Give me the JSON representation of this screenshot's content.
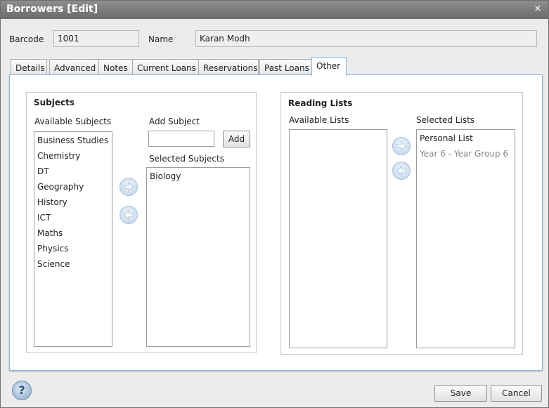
{
  "window": {
    "title": "Borrowers [Edit]",
    "close_glyph": "×"
  },
  "header": {
    "barcode_label": "Barcode",
    "barcode_value": "1001",
    "name_label": "Name",
    "name_value": "Karan Modh"
  },
  "tabs": [
    {
      "label": "Details",
      "active": false
    },
    {
      "label": "Advanced",
      "active": false
    },
    {
      "label": "Notes",
      "active": false
    },
    {
      "label": "Current Loans",
      "active": false
    },
    {
      "label": "Reservations",
      "active": false
    },
    {
      "label": "Past Loans",
      "active": false
    },
    {
      "label": "Other",
      "active": true
    }
  ],
  "subjects": {
    "title": "Subjects",
    "available_label": "Available Subjects",
    "available": [
      "Business Studies",
      "Chemistry",
      "DT",
      "Geography",
      "History",
      "ICT",
      "Maths",
      "Physics",
      "Science"
    ],
    "add_label": "Add Subject",
    "add_input_value": "",
    "add_button": "Add",
    "selected_label": "Selected Subjects",
    "selected": [
      "Biology"
    ]
  },
  "reading_lists": {
    "title": "Reading Lists",
    "available_label": "Available Lists",
    "available": [],
    "selected_label": "Selected Lists",
    "selected": [
      {
        "label": "Personal List",
        "muted": false
      },
      {
        "label": "Year 6 - Year Group 6",
        "muted": true
      }
    ]
  },
  "footer": {
    "save": "Save",
    "cancel": "Cancel",
    "help_glyph": "?"
  },
  "icons": {
    "move_right": "arrow-right-icon",
    "move_left": "arrow-left-icon",
    "help": "help-icon",
    "close": "close-icon"
  },
  "colors": {
    "accent_border": "#8fb3d6",
    "titlebar": "#7a7a7a"
  }
}
